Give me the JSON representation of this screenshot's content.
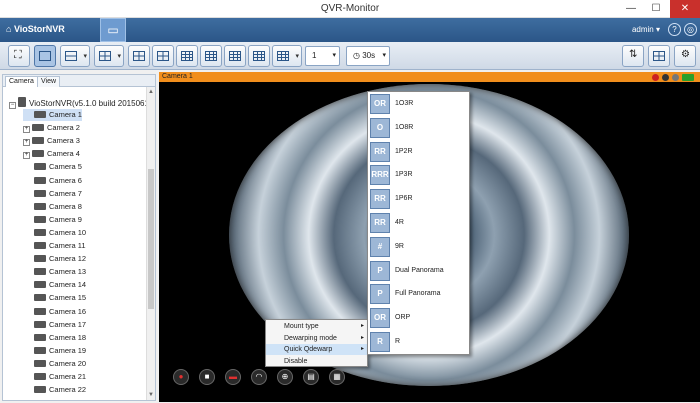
{
  "window": {
    "title": "QVR-Monitor",
    "minimize": "—",
    "maximize": "☐",
    "close": "✕"
  },
  "appbar": {
    "brand": "VioStorNVR",
    "user": "admin",
    "user_arrow": "▾",
    "help_icon": "?",
    "globe_icon": "◎"
  },
  "toolbar": {
    "channel_select": "1",
    "interval_select": "30s"
  },
  "sidebar": {
    "tabs": [
      "Camera",
      "View"
    ],
    "root": "VioStorNVR(v5.1.0 build 2015061(",
    "cameras": [
      "Camera 1",
      "Camera 2",
      "Camera 3",
      "Camera 4",
      "Camera 5",
      "Camera 6",
      "Camera 7",
      "Camera 8",
      "Camera 9",
      "Camera 10",
      "Camera 11",
      "Camera 12",
      "Camera 13",
      "Camera 14",
      "Camera 15",
      "Camera 16",
      "Camera 17",
      "Camera 18",
      "Camera 19",
      "Camera 20",
      "Camera 21",
      "Camera 22"
    ],
    "selected_index": 0
  },
  "viewer": {
    "channel_label": "Camera 1"
  },
  "context_menu": {
    "items": [
      {
        "label": "Mount type",
        "submenu": "▸"
      },
      {
        "label": "Dewarping mode",
        "submenu": "▸"
      },
      {
        "label": "Quick Qdewarp",
        "submenu": "▸"
      },
      {
        "label": "Disable",
        "submenu": ""
      }
    ],
    "highlighted": 2
  },
  "qdewarp_menu": {
    "options": [
      {
        "label": "1O3R",
        "icon": "OR"
      },
      {
        "label": "1O8R",
        "icon": "O"
      },
      {
        "label": "1P2R",
        "icon": "RR"
      },
      {
        "label": "1P3R",
        "icon": "RRR"
      },
      {
        "label": "1P6R",
        "icon": "RR"
      },
      {
        "label": "4R",
        "icon": "RR"
      },
      {
        "label": "9R",
        "icon": "#"
      },
      {
        "label": "Dual Panorama",
        "icon": "P"
      },
      {
        "label": "Full Panorama",
        "icon": "P"
      },
      {
        "label": "ORP",
        "icon": "OR"
      },
      {
        "label": "R",
        "icon": "R"
      }
    ]
  },
  "controls": [
    {
      "name": "record-icon",
      "glyph": "●"
    },
    {
      "name": "snapshot-icon",
      "glyph": "■"
    },
    {
      "name": "audio-icon",
      "glyph": "▬"
    },
    {
      "name": "ptz-icon",
      "glyph": "◠"
    },
    {
      "name": "digital-zoom-icon",
      "glyph": "⊕"
    },
    {
      "name": "playback-icon",
      "glyph": "▤"
    },
    {
      "name": "layout-icon",
      "glyph": "▦"
    }
  ]
}
